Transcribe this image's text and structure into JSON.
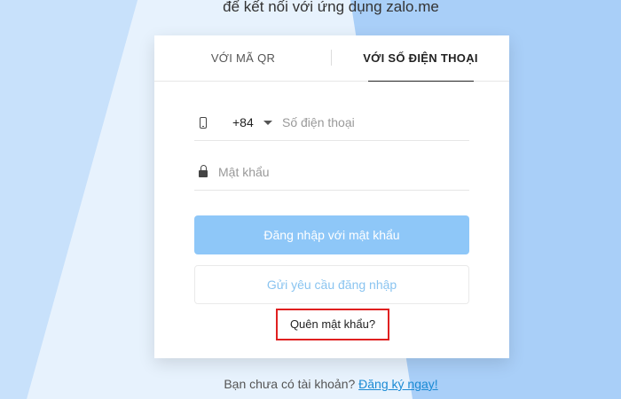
{
  "header": {
    "subtitle": "để kết nối với ứng dụng zalo.me"
  },
  "tabs": [
    {
      "label": "VỚI MÃ QR",
      "active": false
    },
    {
      "label": "VỚI SỐ ĐIỆN THOẠI",
      "active": true
    }
  ],
  "form": {
    "country_code": "+84",
    "phone_placeholder": "Số điện thoại",
    "phone_value": "",
    "password_placeholder": "Mật khẩu",
    "password_value": "",
    "login_button": "Đăng nhập với mật khẩu",
    "request_button": "Gửi yêu cầu đăng nhập",
    "forgot_link": "Quên mật khẩu?"
  },
  "footer": {
    "prompt": "Bạn chưa có tài khoản?",
    "signup_link": "Đăng ký ngay!"
  },
  "icons": {
    "phone": "phone-icon",
    "dropdown": "chevron-down-icon",
    "lock": "lock-icon"
  },
  "colors": {
    "background": "#a9cff8",
    "primary_button": "#8ec7f8",
    "secondary_text": "#8ac4f0",
    "link": "#1a8ad4",
    "highlight_border": "#e02020"
  }
}
